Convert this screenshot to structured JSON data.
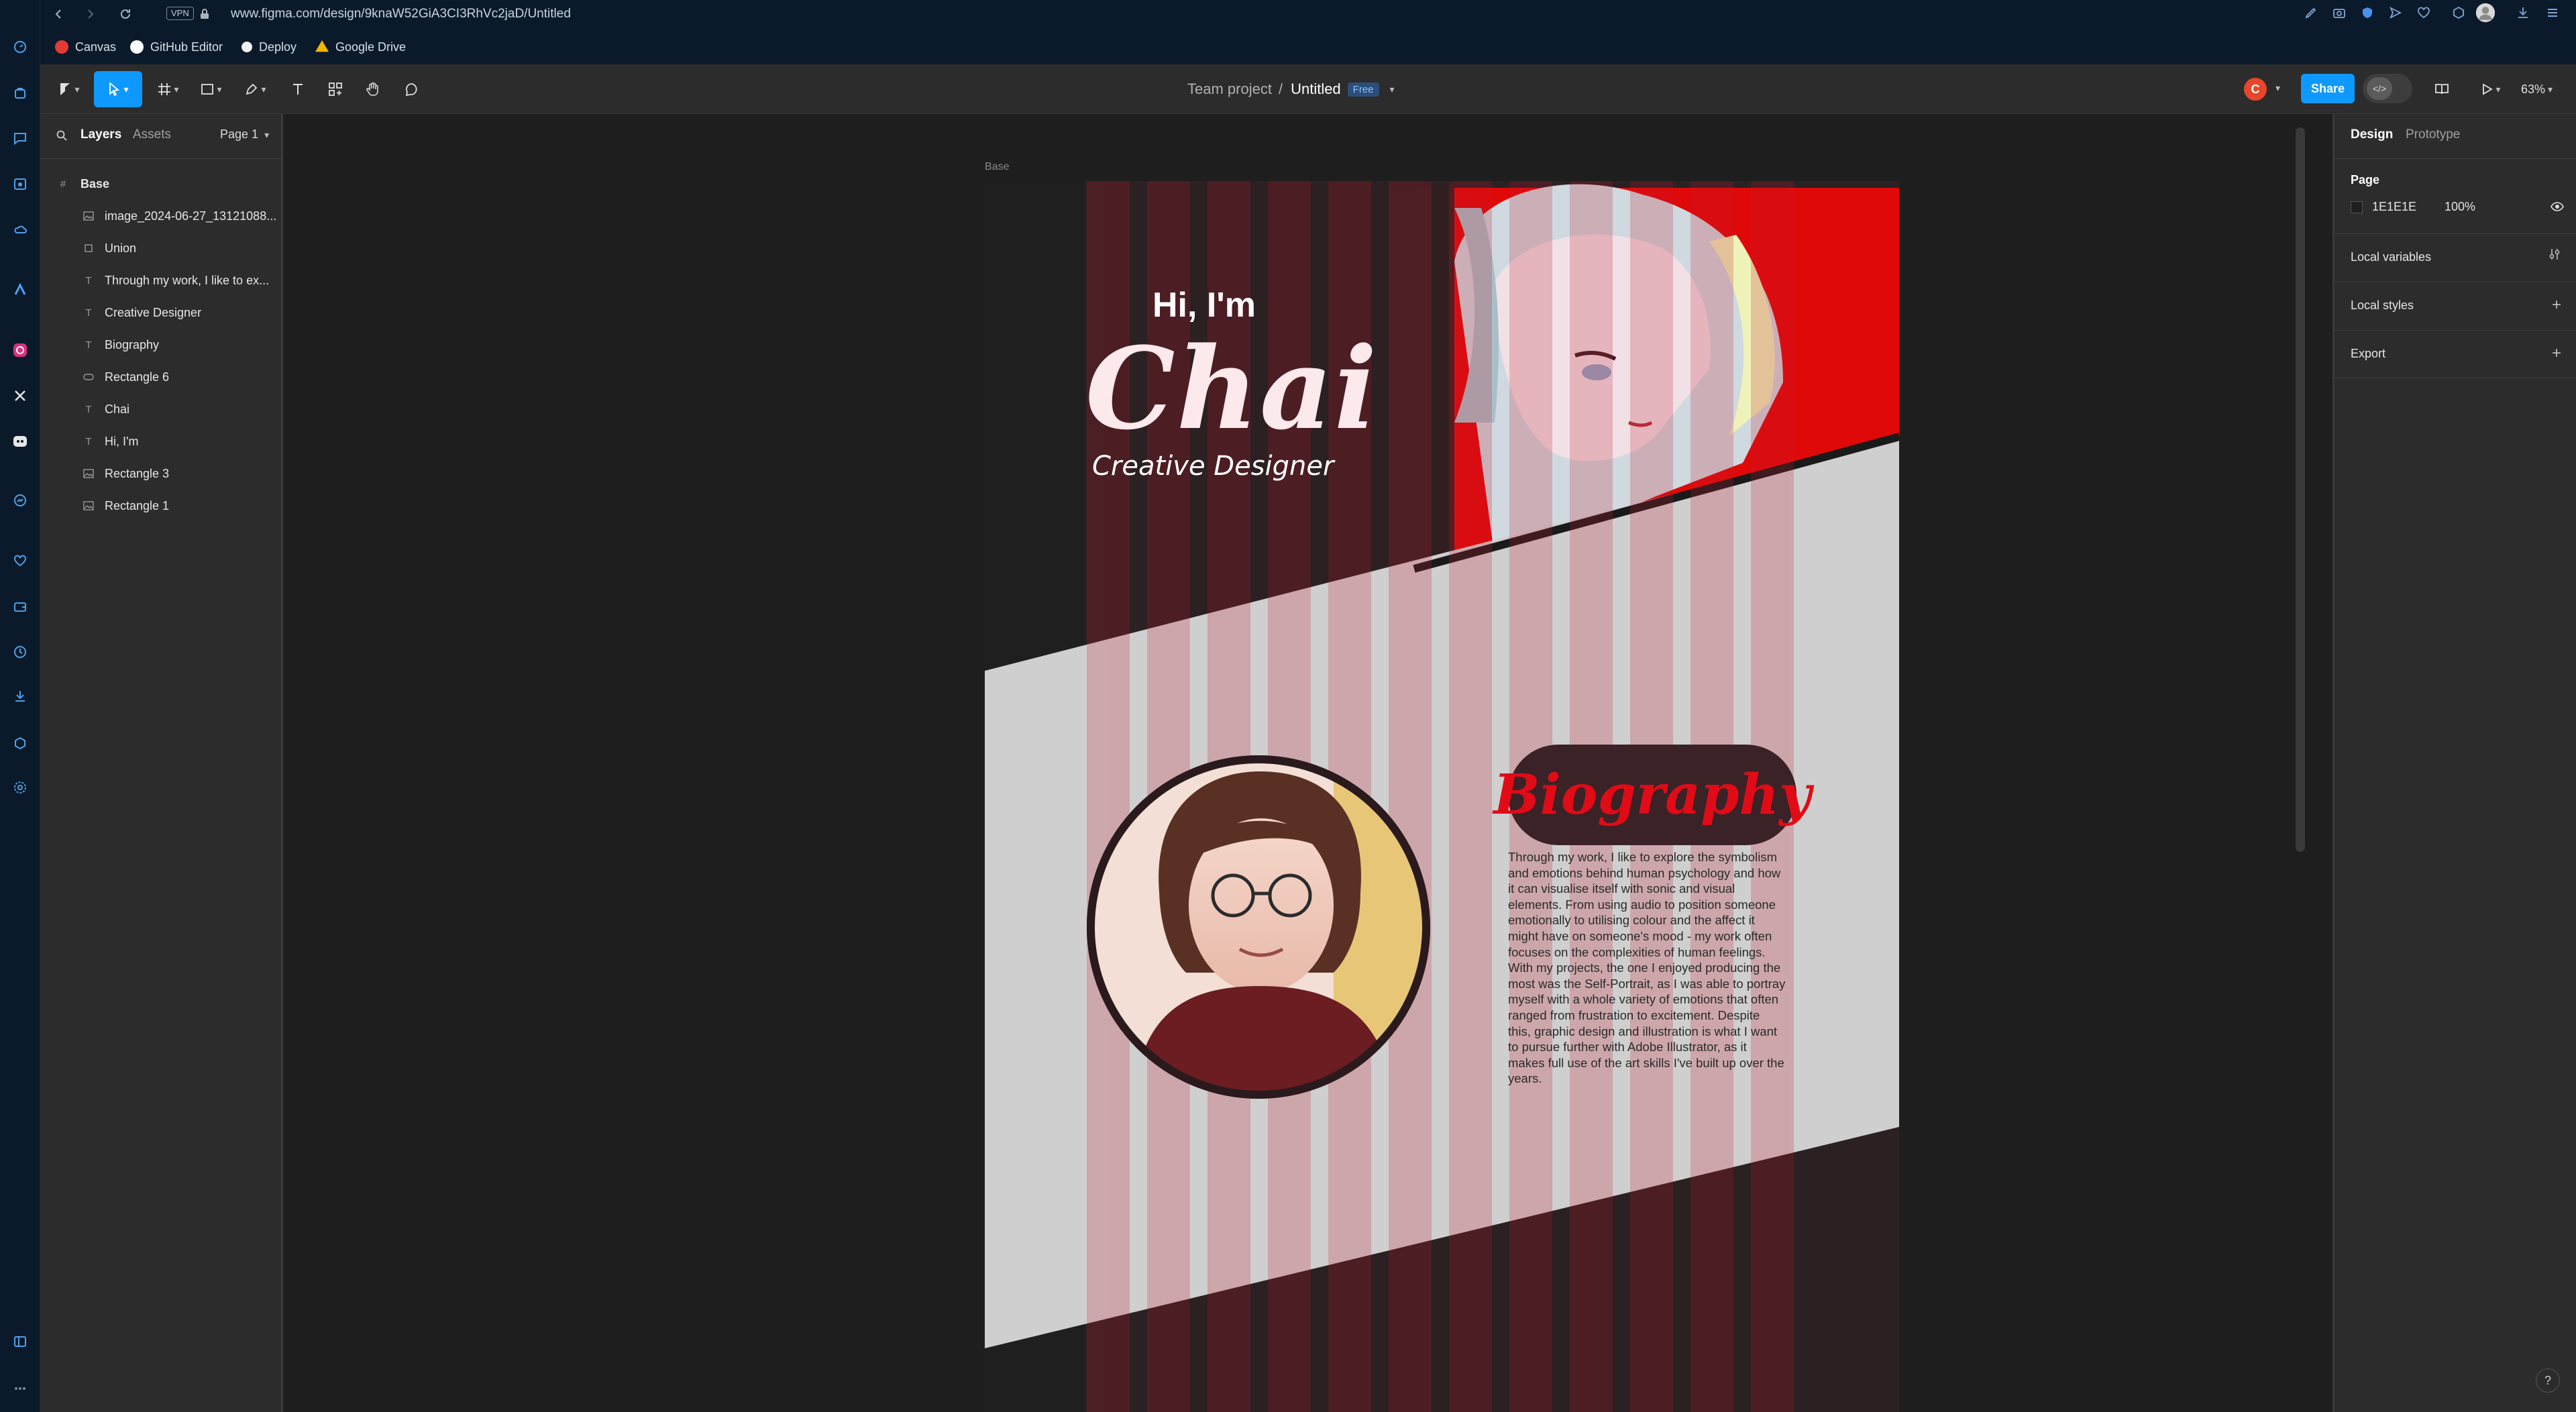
{
  "browser": {
    "vpn_badge": "VPN",
    "url": "www.figma.com/design/9knaW52GiA3CI3RhVc2jaD/Untitled",
    "bookmarks": [
      {
        "label": "Canvas",
        "color": "#e53935"
      },
      {
        "label": "GitHub Editor",
        "color": "#ffffff"
      },
      {
        "label": "Deploy",
        "color": "#f0f0f0"
      },
      {
        "label": "Google Drive",
        "color": "#f4b400"
      }
    ]
  },
  "toolbar": {
    "team": "Team project",
    "separator": "/",
    "file_name": "Untitled",
    "plan_badge": "Free",
    "avatar_letter": "C",
    "share_label": "Share",
    "zoom": "63%"
  },
  "left_panel": {
    "tabs": [
      "Layers",
      "Assets"
    ],
    "page_selector": "Page 1",
    "layers": [
      {
        "name": "Base",
        "icon": "frame-icon"
      },
      {
        "name": "image_2024-06-27_13121088...",
        "icon": "image-icon"
      },
      {
        "name": "Union",
        "icon": "union-icon"
      },
      {
        "name": "Through my work, I like to ex...",
        "icon": "text-icon"
      },
      {
        "name": "Creative Designer",
        "icon": "text-icon"
      },
      {
        "name": "Biography",
        "icon": "text-icon"
      },
      {
        "name": "Rectangle 6",
        "icon": "rectangle-icon"
      },
      {
        "name": "Chai",
        "icon": "text-icon"
      },
      {
        "name": "Hi, I'm",
        "icon": "text-icon"
      },
      {
        "name": "Rectangle 3",
        "icon": "image-icon"
      },
      {
        "name": "Rectangle 1",
        "icon": "image-icon"
      }
    ]
  },
  "canvas": {
    "frame_label": "Base",
    "hero": {
      "greeting": "Hi, I'm",
      "name": "Chai",
      "role": "Creative Designer"
    },
    "biography": {
      "title": "Biography",
      "lines": [
        "Through my work, I like to explore the symbolism",
        "and emotions behind human psychology and how",
        "it can visualise itself with sonic and visual",
        "elements.  From using audio to position someone",
        "emotionally to utilising colour and the affect it",
        "might have on someone's mood - my work often",
        "focuses on the complexities of human feelings.",
        "With my projects, the one I enjoyed producing the",
        "most was the Self-Portrait, as I was able to portray",
        "myself with a whole variety of emotions that often",
        "ranged from frustration to excitement. Despite",
        "this, graphic design and illustration is what I want",
        "to pursue further with Adobe Illustrator, as it",
        "makes full use of the art skills I've built up over the",
        "years."
      ]
    },
    "colors": {
      "accent_red": "#e00b17",
      "panel_light": "#cfcfcf",
      "dark_band": "#3b2428"
    }
  },
  "right_panel": {
    "tabs": [
      "Design",
      "Prototype"
    ],
    "page_heading": "Page",
    "page_fill_hex": "1E1E1E",
    "page_fill_opacity": "100%",
    "sections": [
      "Local variables",
      "Local styles",
      "Export"
    ]
  },
  "help": "?"
}
